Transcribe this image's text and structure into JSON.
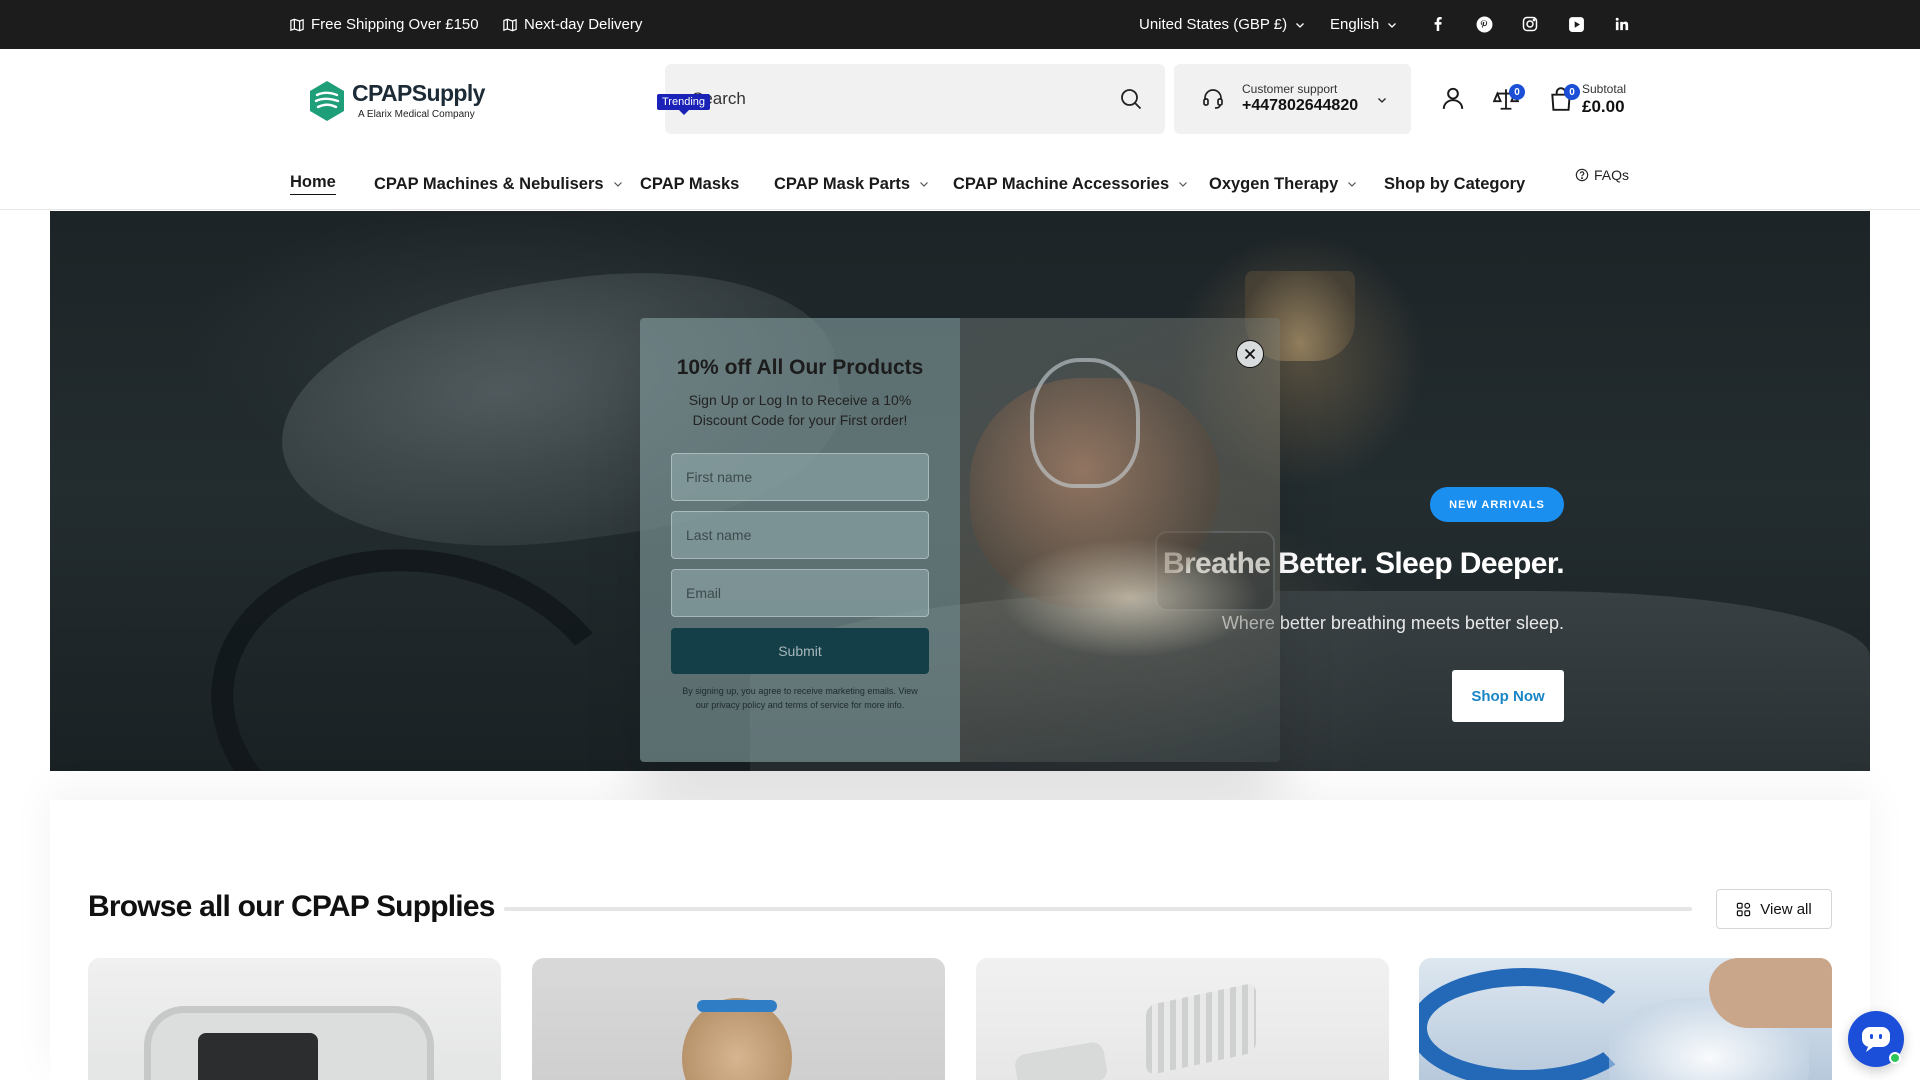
{
  "topbar": {
    "shipping": "Free Shipping Over £150",
    "delivery": "Next-day Delivery",
    "country": "United States (GBP £)",
    "language": "English"
  },
  "header": {
    "logo_title": "CPAPSupply",
    "logo_subtitle": "A Elarix Medical Company",
    "search_placeholder": "Search",
    "support_label": "Customer support",
    "support_phone": "+447802644820",
    "compare_count": "0",
    "cart_count": "0",
    "subtotal_label": "Subtotal",
    "subtotal_value": "£0.00"
  },
  "nav": {
    "items": [
      {
        "label": "Home"
      },
      {
        "label": "CPAP Machines & Nebulisers"
      },
      {
        "label": "CPAP Masks"
      },
      {
        "label": "CPAP Mask Parts"
      },
      {
        "label": "CPAP Machine Accessories"
      },
      {
        "label": "Oxygen Therapy"
      },
      {
        "label": "Shop by Category"
      }
    ],
    "trending_badge": "Trending",
    "faqs": "FAQs"
  },
  "hero": {
    "badge": "NEW ARRIVALS",
    "title": "Breathe Better. Sleep Deeper.",
    "subtitle": "Where better breathing meets better sleep.",
    "cta": "Shop Now"
  },
  "popup": {
    "title": "10% off All Our Products",
    "description": "Sign Up or Log In to Receive a 10% Discount Code for your First order!",
    "first_name_placeholder": "First name",
    "last_name_placeholder": "Last name",
    "email_placeholder": "Email",
    "submit": "Submit",
    "legal": "By signing up, you agree to receive marketing emails. View our privacy policy and terms of service for more info."
  },
  "browse": {
    "title": "Browse all our CPAP Supplies",
    "view_all": "View all"
  },
  "colors": {
    "topbar_bg": "#1c1c1c",
    "accent_blue": "#1a8ff0",
    "logo_green": "#1f9e7a",
    "submit_bg": "#143f48",
    "chat_blue": "#1b4fd9"
  }
}
